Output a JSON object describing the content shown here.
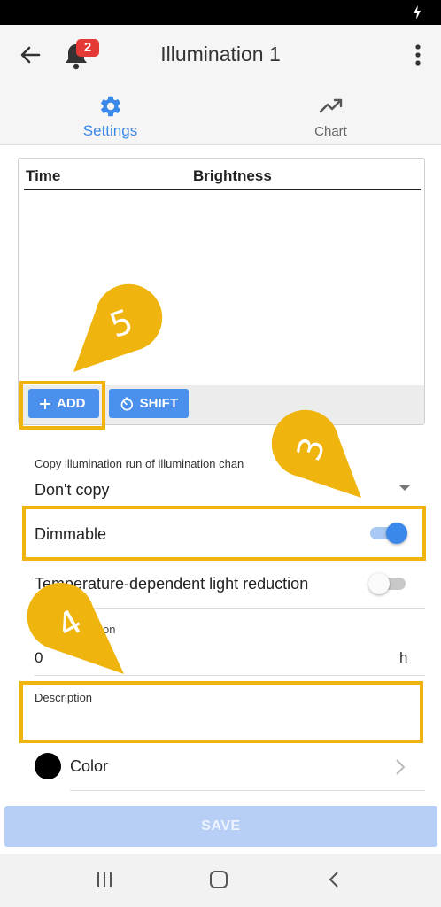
{
  "app_bar": {
    "title": "Illumination 1",
    "notification_count": "2"
  },
  "tabs": [
    {
      "label": "Settings",
      "active": true,
      "icon": "gear-icon"
    },
    {
      "label": "Chart",
      "active": false,
      "icon": "trending-up-icon"
    }
  ],
  "table": {
    "columns": [
      "Time",
      "Brightness"
    ],
    "rows": [],
    "add_label": "ADD",
    "shift_label": "SHIFT"
  },
  "copy": {
    "label": "Copy illumination run of illumination chan",
    "value": "Don't copy"
  },
  "dimmable": {
    "label": "Dimmable",
    "checked": true
  },
  "temp_reduction": {
    "label": "Temperature-dependent light reduction",
    "checked": false
  },
  "duration": {
    "label": "on",
    "value": "0",
    "unit": "h"
  },
  "description": {
    "label": "Description",
    "value": ""
  },
  "color": {
    "label": "Color",
    "value": "#000000"
  },
  "save_label": "SAVE",
  "annotations": [
    "5",
    "3",
    "4"
  ],
  "colors": {
    "accent": "#3a88ea",
    "highlight": "#f0b40f",
    "badge": "#e53935"
  }
}
